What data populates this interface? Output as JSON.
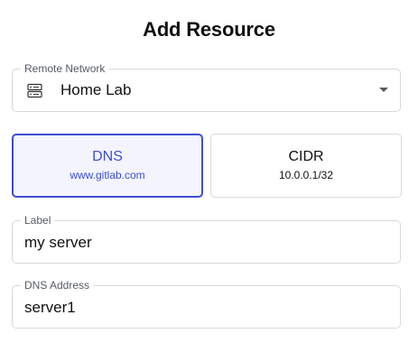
{
  "dialog": {
    "title": "Add Resource"
  },
  "remote_network": {
    "label": "Remote Network",
    "value": "Home Lab",
    "icon": "server-icon"
  },
  "resource_types": [
    {
      "title": "DNS",
      "example": "www.gitlab.com",
      "selected": true
    },
    {
      "title": "CIDR",
      "example": "10.0.0.1/32",
      "selected": false
    }
  ],
  "label_field": {
    "label": "Label",
    "value": "my server"
  },
  "dns_address_field": {
    "label": "DNS Address",
    "value": "server1"
  },
  "colors": {
    "accent": "#3d4ecf",
    "selected_bg": "#f3f4fd",
    "border": "#d9d9de"
  }
}
